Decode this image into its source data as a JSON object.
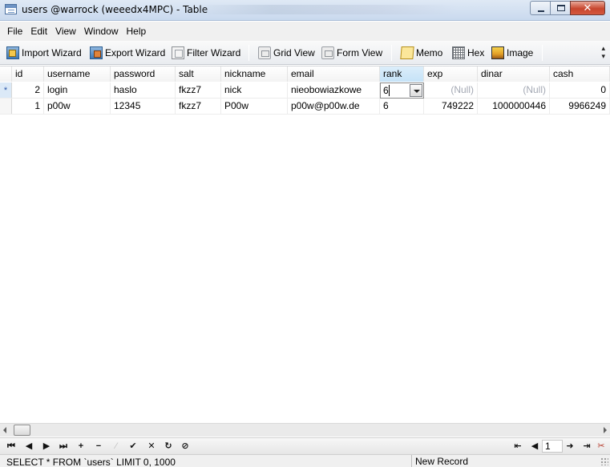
{
  "window": {
    "title": "users @warrock (weeedx4MPC) - Table",
    "minimize_glyph": "",
    "maximize_glyph": "",
    "close_glyph": "✕"
  },
  "menu": [
    "File",
    "Edit",
    "View",
    "Window",
    "Help"
  ],
  "toolbar": {
    "import_wizard": "Import Wizard",
    "export_wizard": "Export Wizard",
    "filter_wizard": "Filter Wizard",
    "grid_view": "Grid View",
    "form_view": "Form View",
    "memo": "Memo",
    "hex": "Hex",
    "image": "Image",
    "more": "▴\n▾"
  },
  "table": {
    "columns": [
      "id",
      "username",
      "password",
      "salt",
      "nickname",
      "email",
      "rank",
      "exp",
      "dinar",
      "cash"
    ],
    "active_column": "rank",
    "rows": [
      {
        "indicator": "*",
        "id": "2",
        "username": "login",
        "password": "haslo",
        "salt": "fkzz7",
        "nickname": "nick",
        "email": "nieobowiazkowe",
        "rank": "6",
        "exp": "(Null)",
        "dinar": "(Null)",
        "cash": "0"
      },
      {
        "indicator": "",
        "id": "1",
        "username": "p00w",
        "password": "12345",
        "salt": "fkzz7",
        "nickname": "P00w",
        "email": "p00w@p00w.de",
        "rank": "6",
        "exp": "749222",
        "dinar": "1000000446",
        "cash": "9966249"
      }
    ]
  },
  "navigator": {
    "first": "⏮",
    "prev": "◀",
    "next": "▶",
    "last": "⏭",
    "add": "+",
    "delete": "−",
    "edit": "⁄",
    "apply": "✔",
    "cancel": "✕",
    "refresh": "↻",
    "stop": "⊘",
    "page_prev": "⇤",
    "page": "1",
    "page_next": "➜",
    "page_last": "⇥",
    "tools": "✂"
  },
  "status": {
    "sql": "SELECT * FROM `users` LIMIT 0, 1000",
    "mode": "New Record"
  }
}
